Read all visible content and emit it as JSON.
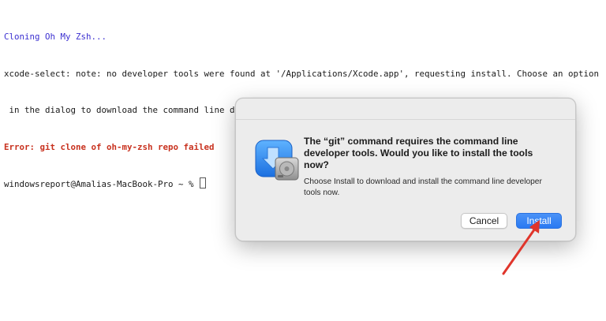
{
  "terminal": {
    "lines": [
      {
        "text": "Cloning Oh My Zsh...",
        "style": "info"
      },
      {
        "text": "xcode-select: note: no developer tools were found at '/Applications/Xcode.app', requesting install. Choose an option",
        "style": "normal"
      },
      {
        "text": " in the dialog to download the command line developer tools.",
        "style": "normal"
      },
      {
        "text": "Error: git clone of oh-my-zsh repo failed",
        "style": "error"
      }
    ],
    "prompt": "windowsreport@Amalias-MacBook-Pro ~ % "
  },
  "dialog": {
    "heading": "The “git” command requires the command line developer tools. Would you like to install the tools now?",
    "body": "Choose Install to download and install the command line developer tools now.",
    "cancel_label": "Cancel",
    "install_label": "Install",
    "icon": "xcode-install-icon"
  },
  "colors": {
    "info_text": "#3b2fd0",
    "error_text": "#c8311e",
    "install_button": "#2a7af2",
    "annotation_arrow": "#e0352b"
  }
}
